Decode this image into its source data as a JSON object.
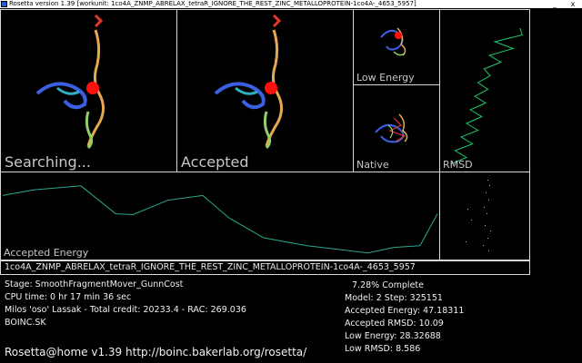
{
  "window": {
    "title": "Rosetta version 1.39 [workunit: 1co4A_ZNMP_ABRELAX_tetraR_IGNORE_THE_REST_ZINC_METALLOPROTEIN-1co4A-_4653_5957]",
    "minimize_glyph": "_",
    "close_glyph": "x"
  },
  "panels": {
    "searching_label": "Searching...",
    "accepted_label": "Accepted",
    "low_energy_label": "Low Energy",
    "native_label": "Native",
    "rmsd_label": "RMSD",
    "accepted_energy_label": "Accepted Energy"
  },
  "workunit_name": "1co4A_ZNMP_ABRELAX_tetraR_IGNORE_THE_REST_ZINC_METALLOPROTEIN-1co4A-_4653_5957",
  "status": {
    "stage": "Stage: SmoothFragmentMover_GunnCost",
    "cpu_time": "CPU time: 0 hr 17 min 36 sec",
    "user_credit": "Milos 'oso' Lassak - Total credit: 20233.4 - RAC: 269.036",
    "team": "BOINC.SK",
    "percent_complete": "7.28% Complete",
    "model_step": "Model: 2  Step: 325151",
    "accepted_energy": "Accepted Energy: 47.18311",
    "accepted_rmsd": "Accepted RMSD: 10.09",
    "low_energy": "Low Energy: 28.32688",
    "low_rmsd": "Low RMSD: 8.586"
  },
  "footer": {
    "text": "Rosetta@home v1.39 http://boinc.bakerlab.org/rosetta/"
  },
  "colors": {
    "background": "#000000",
    "panel_border": "#d8d8d8",
    "energy_trace": "#2aa890",
    "rmsd_trace": "#1fc86a",
    "zinc_sphere": "#ff1010"
  },
  "charts": {
    "rmsd_trace": {
      "type": "line",
      "values": [
        0.95,
        0.98,
        0.62,
        0.86,
        0.55,
        0.7,
        0.48,
        0.56,
        0.4,
        0.53,
        0.36,
        0.5,
        0.3,
        0.45,
        0.25,
        0.4,
        0.18,
        0.33,
        0.1,
        0.25,
        0.04
      ]
    },
    "accepted_energy_trace": {
      "type": "line",
      "x": [
        0,
        0.07,
        0.18,
        0.26,
        0.3,
        0.38,
        0.46,
        0.52,
        0.6,
        0.7,
        0.78,
        0.84,
        0.9,
        0.96,
        1.0
      ],
      "values": [
        0.78,
        0.85,
        0.9,
        0.55,
        0.54,
        0.72,
        0.78,
        0.5,
        0.25,
        0.15,
        0.1,
        0.06,
        0.13,
        0.15,
        0.55
      ]
    }
  }
}
